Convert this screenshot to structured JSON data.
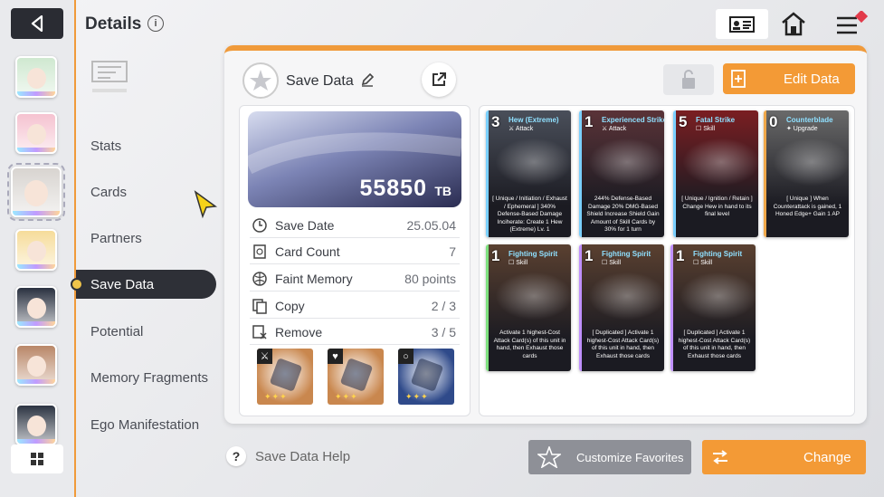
{
  "header": {
    "title": "Details",
    "info_icon": "i",
    "top_icons": [
      "id-card-icon",
      "home-icon",
      "menu-icon"
    ]
  },
  "sidebar": {
    "back_icon": "back-arrow-icon",
    "portraits": [
      {
        "name": "portrait-1",
        "color": "#cfe8d0"
      },
      {
        "name": "portrait-2",
        "color": "#f5c2d0"
      },
      {
        "name": "portrait-3",
        "color": "#d8d4d0",
        "selected": true
      },
      {
        "name": "portrait-4",
        "color": "#f6dc9a"
      },
      {
        "name": "portrait-5",
        "color": "#2a3140"
      },
      {
        "name": "portrait-6",
        "color": "#b98768"
      },
      {
        "name": "portrait-7",
        "color": "#2c3442"
      }
    ],
    "grid_icon": "grid-icon"
  },
  "menu": {
    "items": [
      {
        "label": "Stats"
      },
      {
        "label": "Cards"
      },
      {
        "label": "Partners"
      },
      {
        "label": "Save Data",
        "active": true
      },
      {
        "label": "Potential"
      },
      {
        "label": "Memory Fragments"
      },
      {
        "label": "Ego Manifestation"
      }
    ]
  },
  "save_data": {
    "title": "Save Data",
    "edit_button": "Edit Data",
    "score": "55850",
    "score_unit": "TB",
    "stats": [
      {
        "label": "Save Date",
        "value": "25.05.04",
        "icon": "clock-icon"
      },
      {
        "label": "Card Count",
        "value": "7",
        "icon": "card-icon"
      },
      {
        "label": "Faint Memory",
        "value": "80 points",
        "icon": "brain-icon"
      },
      {
        "label": "Copy",
        "value": "2 / 3",
        "icon": "copy-icon"
      },
      {
        "label": "Remove",
        "value": "3 / 5",
        "icon": "remove-icon"
      }
    ],
    "equipment": [
      {
        "name": "weapon",
        "tag": "⚔",
        "stars": "✦✦✦",
        "color": "#c9874e"
      },
      {
        "name": "armor",
        "tag": "♥",
        "stars": "✦✦✦",
        "color": "#c9874e"
      },
      {
        "name": "accessory",
        "tag": "○",
        "stars": "✦✦✦",
        "color": "#2f4a8a"
      }
    ]
  },
  "cards": [
    {
      "cost": "3",
      "name": "Hew (Extreme)",
      "type": "⚔ Attack",
      "desc": "[ Unique / Initiation / Exhaust / Ephemeral ] 340% Defense-Based Damage Inciherate: Create 1 Hew (Extreme) Lv. 1",
      "art": "#4a4f5a",
      "border": "#7ad0ff"
    },
    {
      "cost": "1",
      "name": "Experienced Strike",
      "type": "⚔ Attack",
      "desc": "244% Defense-Based Damage 20% DMG-Based Shield Increase Shield Gain Amount of Skill Cards by 30% for 1 turn",
      "art": "#5a3338",
      "border": "#7ad0ff"
    },
    {
      "cost": "5",
      "name": "Fatal Strike",
      "type": "☐ Skill",
      "desc": "[ Unique / Ignition / Retain ] Change Hew in hand to its final level",
      "art": "#7a1e22",
      "border": "#7ad0ff"
    },
    {
      "cost": "0",
      "name": "Counterblade",
      "type": "✦ Upgrade",
      "desc": "[ Unique ] When Counterattack is gained, 1 Honed Edge+ Gain 1 AP",
      "art": "#6a6a6a",
      "border": "#f0a84a"
    },
    {
      "cost": "1",
      "name": "Fighting Spirit",
      "type": "☐ Skill",
      "desc": "Activate 1 highest-Cost Attack Card(s) of this unit in hand, then Exhaust those cards",
      "art": "#5a4030",
      "border": "#7ee07e"
    },
    {
      "cost": "1",
      "name": "Fighting Spirit",
      "type": "☐ Skill",
      "desc": "[ Duplicated ] Activate 1 highest-Cost Attack Card(s) of this unit in hand, then Exhaust those cards",
      "art": "#5a4030",
      "border": "#c090ff"
    },
    {
      "cost": "1",
      "name": "Fighting Spirit",
      "type": "☐ Skill",
      "desc": "[ Duplicated ] Activate 1 highest-Cost Attack Card(s) of this unit in hand, then Exhaust those cards",
      "art": "#5a4030",
      "border": "#c090ff"
    }
  ],
  "footer": {
    "help_label": "Save Data Help",
    "help_icon": "?",
    "favorites_button": "Customize Favorites",
    "change_button": "Change"
  },
  "colors": {
    "accent": "#f39a36",
    "dark": "#2e3037"
  }
}
